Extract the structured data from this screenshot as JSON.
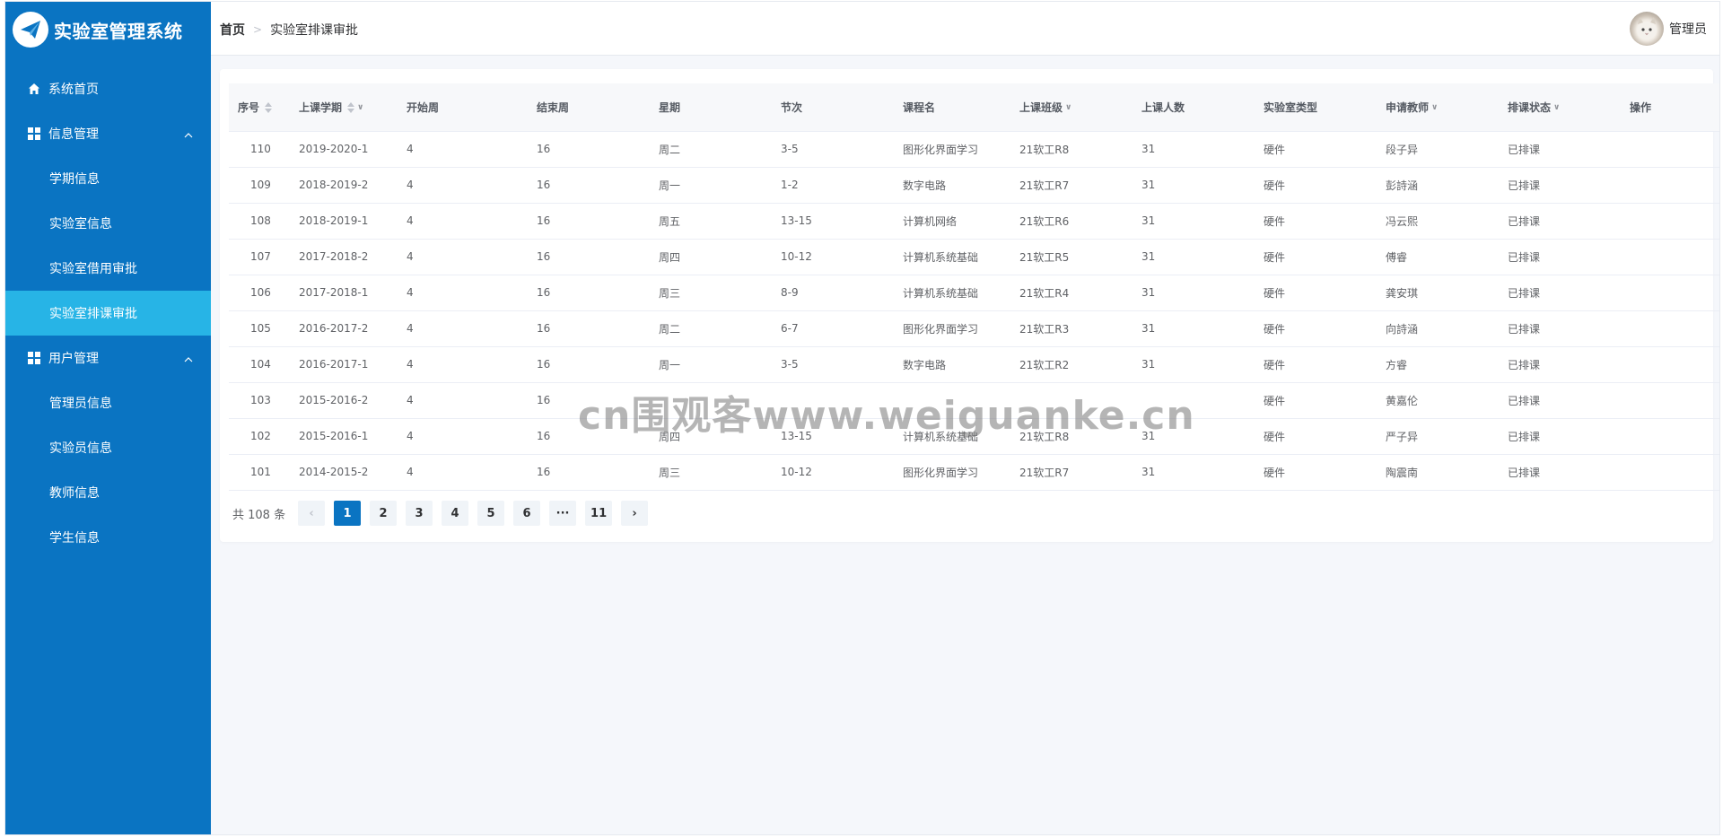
{
  "app": {
    "title": "实验室管理系统"
  },
  "sidebar": {
    "items": [
      {
        "label": "系统首页",
        "icon": "home-icon"
      },
      {
        "label": "信息管理",
        "icon": "grid-icon",
        "expanded": true
      },
      {
        "label": "学期信息"
      },
      {
        "label": "实验室信息"
      },
      {
        "label": "实验室借用审批"
      },
      {
        "label": "实验室排课审批",
        "active": true
      },
      {
        "label": "用户管理",
        "icon": "grid-icon",
        "expanded": true
      },
      {
        "label": "管理员信息"
      },
      {
        "label": "实验员信息"
      },
      {
        "label": "教师信息"
      },
      {
        "label": "学生信息"
      }
    ]
  },
  "header": {
    "breadcrumb": {
      "home": "首页",
      "current": "实验室排课审批"
    },
    "user": {
      "name": "管理员"
    }
  },
  "table": {
    "columns": [
      "序号",
      "上课学期",
      "开始周",
      "结束周",
      "星期",
      "节次",
      "课程名",
      "上课班级",
      "上课人数",
      "实验室类型",
      "申请教师",
      "排课状态",
      "操作"
    ],
    "rows": [
      [
        "110",
        "2019-2020-1",
        "4",
        "16",
        "周二",
        "3-5",
        "图形化界面学习",
        "21软工R8",
        "31",
        "硬件",
        "段子异",
        "已排课",
        ""
      ],
      [
        "109",
        "2018-2019-2",
        "4",
        "16",
        "周一",
        "1-2",
        "数字电路",
        "21软工R7",
        "31",
        "硬件",
        "彭詩涵",
        "已排课",
        ""
      ],
      [
        "108",
        "2018-2019-1",
        "4",
        "16",
        "周五",
        "13-15",
        "计算机网络",
        "21软工R6",
        "31",
        "硬件",
        "冯云熙",
        "已排课",
        ""
      ],
      [
        "107",
        "2017-2018-2",
        "4",
        "16",
        "周四",
        "10-12",
        "计算机系统基础",
        "21软工R5",
        "31",
        "硬件",
        "傅睿",
        "已排课",
        ""
      ],
      [
        "106",
        "2017-2018-1",
        "4",
        "16",
        "周三",
        "8-9",
        "计算机系统基础",
        "21软工R4",
        "31",
        "硬件",
        "龚安琪",
        "已排课",
        ""
      ],
      [
        "105",
        "2016-2017-2",
        "4",
        "16",
        "周二",
        "6-7",
        "图形化界面学习",
        "21软工R3",
        "31",
        "硬件",
        "向詩涵",
        "已排课",
        ""
      ],
      [
        "104",
        "2016-2017-1",
        "4",
        "16",
        "周一",
        "3-5",
        "数字电路",
        "21软工R2",
        "31",
        "硬件",
        "方睿",
        "已排课",
        ""
      ],
      [
        "103",
        "2015-2016-2",
        "4",
        "16",
        "",
        "",
        "",
        "",
        "",
        "硬件",
        "黄嘉伦",
        "已排课",
        ""
      ],
      [
        "102",
        "2015-2016-1",
        "4",
        "16",
        "周四",
        "13-15",
        "计算机系统基础",
        "21软工R8",
        "31",
        "硬件",
        "严子异",
        "已排课",
        ""
      ],
      [
        "101",
        "2014-2015-2",
        "4",
        "16",
        "周三",
        "10-12",
        "图形化界面学习",
        "21软工R7",
        "31",
        "硬件",
        "陶震南",
        "已排课",
        ""
      ]
    ]
  },
  "pagination": {
    "total_text": "共 108 条",
    "prev": "‹",
    "pages": [
      "1",
      "2",
      "3",
      "4",
      "5",
      "6",
      "···",
      "11"
    ],
    "current": "1",
    "next": "›"
  },
  "watermark": "cn围观客www.weiguanke.cn",
  "colors": {
    "sidebar": "#0a74c2",
    "active_menu": "#27b4e6",
    "page_bg": "#f5f7fb"
  }
}
